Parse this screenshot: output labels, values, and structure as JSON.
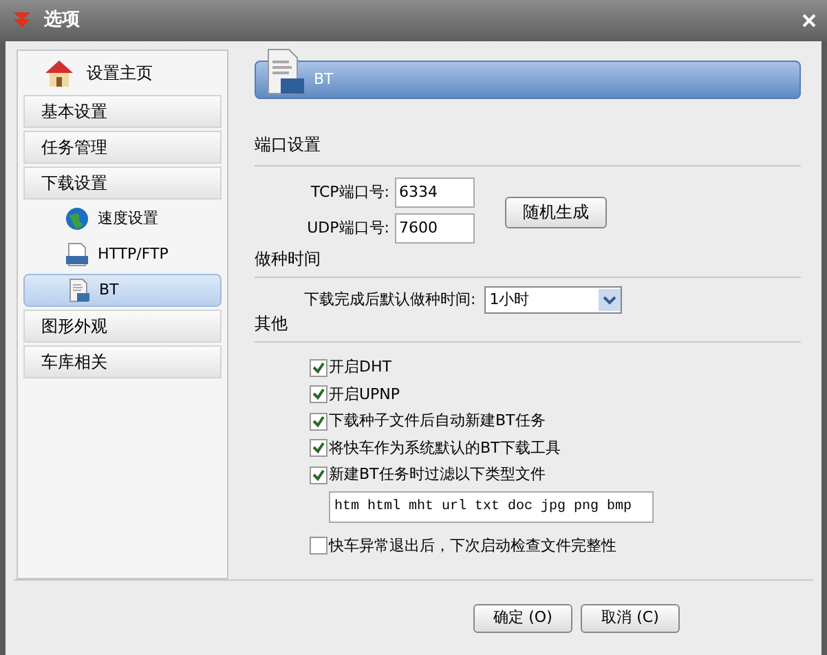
{
  "window": {
    "title": "选项"
  },
  "sidebar": {
    "home": {
      "label": "设置主页"
    },
    "items": [
      {
        "label": "基本设置",
        "kind": "section",
        "selected": false
      },
      {
        "label": "任务管理",
        "kind": "section",
        "selected": false
      },
      {
        "label": "下载设置",
        "kind": "section",
        "selected": false
      },
      {
        "label": "速度设置",
        "kind": "globe",
        "selected": false
      },
      {
        "label": "HTTP/FTP",
        "kind": "http",
        "selected": false
      },
      {
        "label": "BT",
        "kind": "bt",
        "selected": true
      },
      {
        "label": "图形外观",
        "kind": "section",
        "selected": false
      },
      {
        "label": "车库相关",
        "kind": "section",
        "selected": false
      }
    ]
  },
  "header": {
    "title": "BT"
  },
  "ports": {
    "title": "端口设置",
    "fields": [
      {
        "label": "TCP端口号:",
        "value": "6334"
      },
      {
        "label": "UDP端口号:",
        "value": "7600"
      }
    ],
    "random_button": "随机生成"
  },
  "seeding": {
    "title": "做种时间",
    "label": "下载完成后默认做种时间:",
    "value": "1小时"
  },
  "other": {
    "title": "其他",
    "items": [
      {
        "kind": "checkbox",
        "label": "开启DHT",
        "checked": true
      },
      {
        "kind": "checkbox",
        "label": "开启UPNP",
        "checked": true
      },
      {
        "kind": "checkbox",
        "label": "下载种子文件后自动新建BT任务",
        "checked": true
      },
      {
        "kind": "checkbox",
        "label": "将快车作为系统默认的BT下载工具",
        "checked": true
      },
      {
        "kind": "checkbox",
        "label": "新建BT任务时过滤以下类型文件",
        "checked": true
      },
      {
        "kind": "field",
        "value": "htm html mht url txt doc jpg png bmp"
      },
      {
        "kind": "checkbox",
        "label": "快车异常退出后，下次启动检查文件完整性",
        "checked": false
      }
    ]
  },
  "buttons": [
    {
      "label": "确定 (O)"
    },
    {
      "label": "取消 (C)"
    }
  ]
}
